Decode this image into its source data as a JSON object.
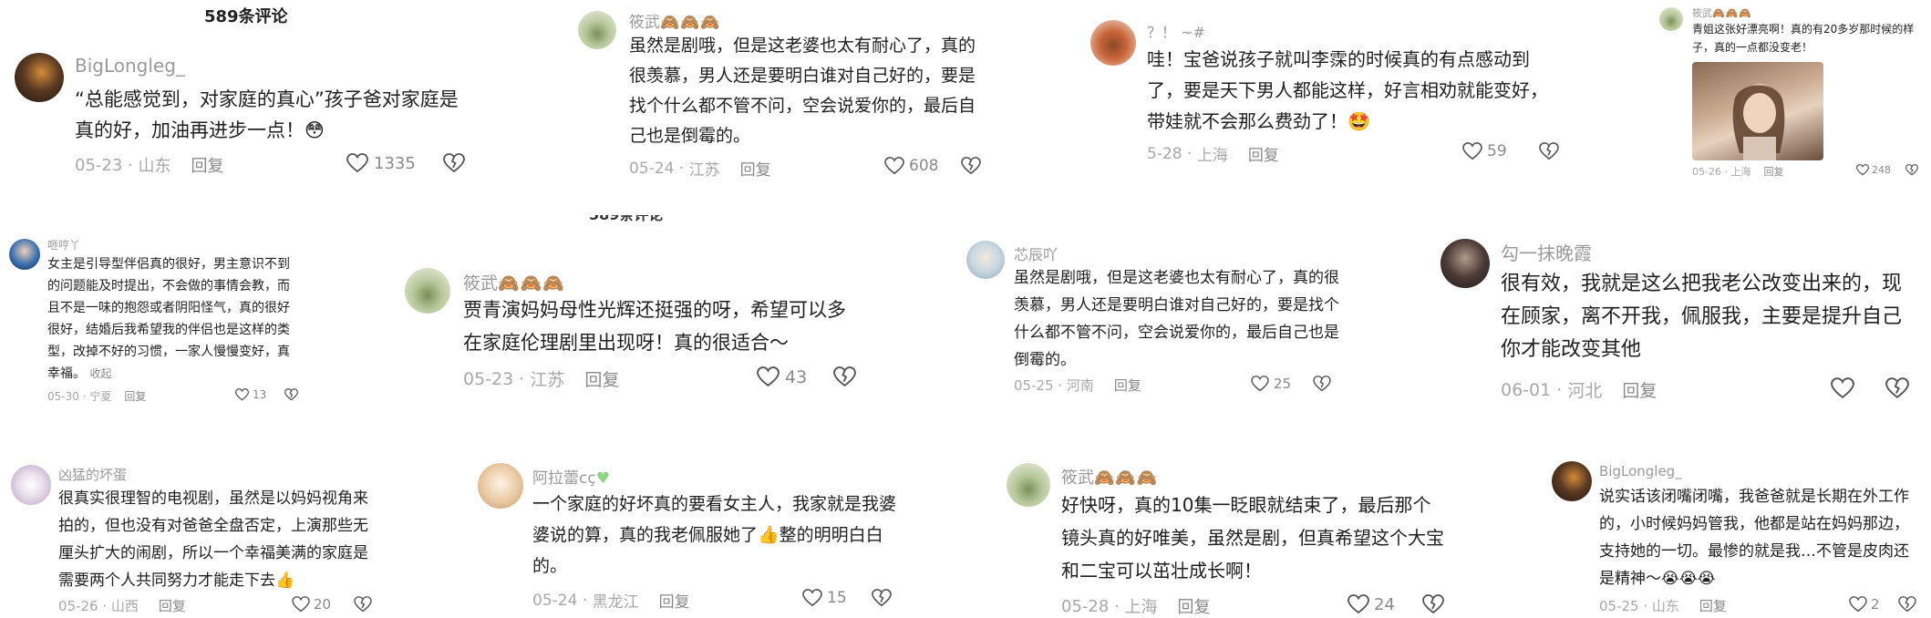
{
  "header": {
    "count_title": "589条评论",
    "clipped_title": "589条评论"
  },
  "comments": [
    {
      "user": "BigLongleg_",
      "text": "“总能感觉到，对家庭的真心”孩子爸对家庭是真的好，加油再进步一点！",
      "date": "05-23",
      "location": "山东",
      "reply": "回复",
      "likes": "1335",
      "avatar_color": "#5a3a22",
      "emoji": "😳"
    },
    {
      "user": "筱武",
      "tags": "🙈🙈🙈",
      "text": "虽然是剧哦，但是这老婆也太有耐心了，真的很羡慕，男人还是要明白谁对自己好的，要是找个什么都不管不问，空会说爱你的，最后自己也是倒霉的。",
      "date": "05-24",
      "location": "江苏",
      "reply": "回复",
      "likes": "608",
      "avatar_color": "#b7c79a"
    },
    {
      "user": "？！ ~#",
      "text": "哇！宝爸说孩子就叫李霂的时候真的有点感动到了，要是天下男人都能这样，好言相劝就能变好，带娃就不会那么费劲了！",
      "date": "5-28",
      "location": "上海",
      "reply": "回复",
      "likes": "59",
      "avatar_color": "#c9643a",
      "emoji": "🤩"
    },
    {
      "user": "筱武",
      "tags": "🙈🙈🙈",
      "text": "青姐这张好漂亮啊！真的有20多岁那时候的样子，真的一点都没变老！",
      "date": "05-26",
      "location": "上海",
      "reply": "回复",
      "likes": "248",
      "avatar_color": "#b7c79a"
    },
    {
      "user": "咂哼丫",
      "text": "女主是引导型伴侣真的很好，男主意识不到的问题能及时提出，不会做的事情会教，而且不是一味的抱怨或者阴阳怪气，真的很好很好，结婚后我希望我的伴侣也是这样的类型，改掉不好的习惯，一家人慢慢变好，真幸福。",
      "fold": "收起",
      "date": "05-30",
      "location": "宁夏",
      "reply": "回复",
      "likes": "13",
      "avatar_color": "#3a6fb0"
    },
    {
      "user": "筱武",
      "tags": "🙈🙈🙈",
      "text": "贾青演妈妈母性光辉还挺强的呀，希望可以多在家庭伦理剧里出现呀！真的很适合～",
      "date": "05-23",
      "location": "江苏",
      "reply": "回复",
      "likes": "43",
      "avatar_color": "#b7c79a"
    },
    {
      "user": "芯辰吖",
      "text": "虽然是剧哦，但是这老婆也太有耐心了，真的很羡慕，男人还是要明白谁对自己好的，要是找个什么都不管不问，空会说爱你的，最后自己也是倒霉的。",
      "date": "05-25",
      "location": "河南",
      "reply": "回复",
      "likes": "25",
      "avatar_color": "#c8d7e0"
    },
    {
      "user": "勾一抹晚霞",
      "text": "很有效，我就是这么把我老公改变出来的，现在顾家，离不开我，佩服我，主要是提升自己你才能改变其他",
      "date": "06-01",
      "location": "河北",
      "reply": "回复",
      "likes": "",
      "avatar_color": "#4a3a36"
    },
    {
      "user": "凶猛的坏蛋",
      "text": "很真实很理智的电视剧，虽然是以妈妈视角来拍的，但也没有对爸爸全盘否定，上演那些无厘头扩大的闹剧，所以一个幸福美满的家庭是需要两个人共同努力才能走下去",
      "date": "05-26",
      "location": "山西",
      "reply": "回复",
      "likes": "20",
      "avatar_color": "#e7dcea",
      "emoji": "👍"
    },
    {
      "user": "阿拉蕾cç",
      "text": "一个家庭的好坏真的要看女主人，我家就是我婆婆说的算，真的我老佩服她了👍整的明明白白的。",
      "date": "05-24",
      "location": "黑龙江",
      "reply": "回复",
      "likes": "15",
      "avatar_color": "#e8c7a0"
    },
    {
      "user": "筱武",
      "tags": "🙈🙈🙈",
      "text": "好快呀，真的10集一眨眼就结束了，最后那个镜头真的好唯美，虽然是剧，但真希望这个大宝和二宝可以茁壮成长啊！",
      "date": "05-28",
      "location": "上海",
      "reply": "回复",
      "likes": "24",
      "avatar_color": "#b7c79a"
    },
    {
      "user": "BigLongleg_",
      "text": "说实话该闭嘴闭嘴，我爸爸就是长期在外工作的，小时候妈妈管我，他都是站在妈妈那边，支持她的一切。最惨的就是我…不管是皮肉还是精神～😭😭😭",
      "date": "05-25",
      "location": "山东",
      "reply": "回复",
      "likes": "2",
      "avatar_color": "#5a3a22"
    }
  ],
  "icons": {
    "like": "heart-outline-icon",
    "dislike": "broken-heart-icon"
  }
}
